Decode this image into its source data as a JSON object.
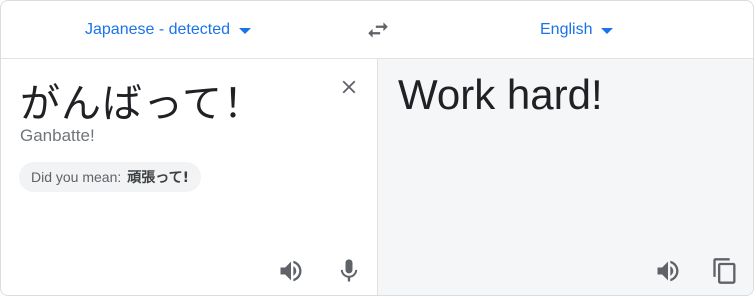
{
  "languages": {
    "source_label": "Japanese - detected",
    "target_label": "English",
    "accent_color": "#1a73e8"
  },
  "source": {
    "text": "がんばって！",
    "romanization": "Ganbatte!",
    "suggestion_prefix": "Did you mean:",
    "suggestion_term": "頑張って!"
  },
  "target": {
    "text": "Work hard!"
  },
  "icons": {
    "swap": "swap-arrows-icon",
    "clear": "close-icon",
    "speak": "speaker-icon",
    "mic": "microphone-icon",
    "copy": "copy-icon"
  }
}
